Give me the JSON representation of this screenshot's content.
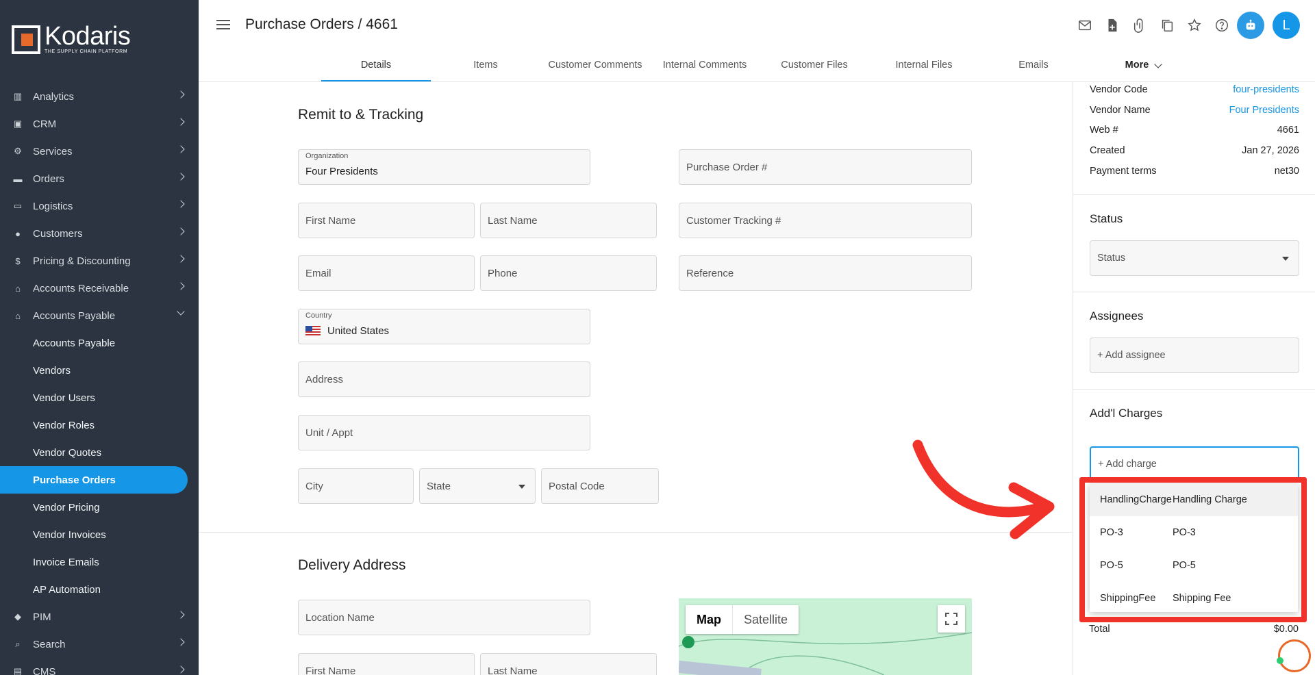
{
  "brand": {
    "name": "Kodaris",
    "tagline": "THE SUPPLY CHAIN PLATFORM",
    "accent": "#1596e6",
    "logo_orange": "#e86a2a"
  },
  "sidebar": {
    "items": [
      {
        "label": "Analytics",
        "icon": "analytics-icon"
      },
      {
        "label": "CRM",
        "icon": "crm-icon"
      },
      {
        "label": "Services",
        "icon": "services-icon"
      },
      {
        "label": "Orders",
        "icon": "truck-icon"
      },
      {
        "label": "Logistics",
        "icon": "logistics-icon"
      },
      {
        "label": "Customers",
        "icon": "people-icon"
      },
      {
        "label": "Pricing & Discounting",
        "icon": "dollar-icon"
      },
      {
        "label": "Accounts Receivable",
        "icon": "bank-icon"
      },
      {
        "label": "Accounts Payable",
        "icon": "bank-icon",
        "expanded": true
      }
    ],
    "sub_items": [
      "Accounts Payable",
      "Vendors",
      "Vendor Users",
      "Vendor Roles",
      "Vendor Quotes",
      "Purchase Orders",
      "Vendor Pricing",
      "Vendor Invoices",
      "Invoice Emails",
      "AP Automation"
    ],
    "active_sub": "Purchase Orders",
    "after": [
      {
        "label": "PIM",
        "icon": "tag-icon"
      },
      {
        "label": "Search",
        "icon": "search-icon"
      },
      {
        "label": "CMS",
        "icon": "cms-icon"
      }
    ]
  },
  "header": {
    "title": "Purchase Orders / 4661",
    "tabs": [
      "Details",
      "Items",
      "Customer Comments",
      "Internal Comments",
      "Customer Files",
      "Internal Files",
      "Emails"
    ],
    "more_label": "More",
    "active_tab": "Details",
    "avatar_letter": "L"
  },
  "remit": {
    "title": "Remit to & Tracking",
    "organization_label": "Organization",
    "organization_value": "Four Presidents",
    "purchase_order_placeholder": "Purchase Order #",
    "first_name": "First Name",
    "last_name": "Last Name",
    "customer_tracking": "Customer Tracking #",
    "email": "Email",
    "phone": "Phone",
    "reference": "Reference",
    "country_label": "Country",
    "country_value": "United States",
    "address": "Address",
    "unit": "Unit / Appt",
    "city": "City",
    "state": "State",
    "postal": "Postal Code"
  },
  "delivery": {
    "title": "Delivery Address",
    "location_name": "Location Name",
    "first_name": "First Name",
    "last_name": "Last Name",
    "map_tab": "Map",
    "satellite_tab": "Satellite"
  },
  "details_panel": {
    "rows": [
      {
        "key": "Vendor Code",
        "value": "four-presidents",
        "link": true
      },
      {
        "key": "Vendor Name",
        "value": "Four Presidents",
        "link": true
      },
      {
        "key": "Web #",
        "value": "4661",
        "link": false
      },
      {
        "key": "Created",
        "value": "Jan 27, 2026",
        "link": false
      },
      {
        "key": "Payment terms",
        "value": "net30",
        "link": false
      }
    ],
    "status_title": "Status",
    "status_placeholder": "Status",
    "assignees_title": "Assignees",
    "add_assignee": "+ Add assignee",
    "charges_title": "Add'l Charges",
    "add_charge": "+ Add charge",
    "charge_options": [
      {
        "code": "HandlingCharge",
        "name": "Handling Charge"
      },
      {
        "code": "PO-3",
        "name": "PO-3"
      },
      {
        "code": "PO-5",
        "name": "PO-5"
      },
      {
        "code": "ShippingFee",
        "name": "Shipping Fee"
      }
    ],
    "total_label": "Total",
    "total_value": "$0.00"
  }
}
